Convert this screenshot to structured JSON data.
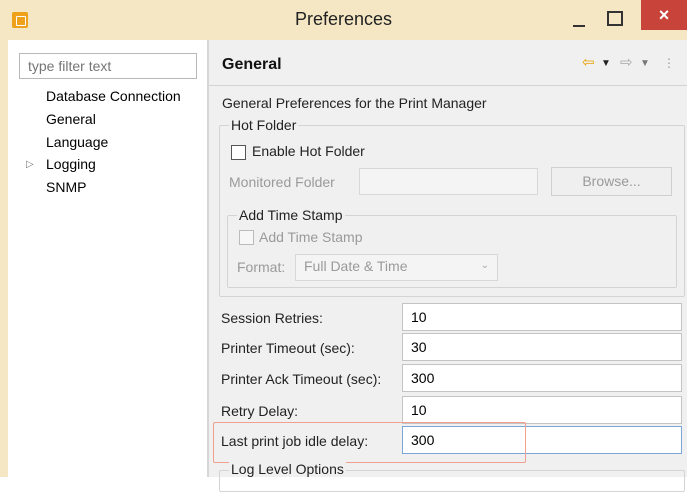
{
  "window": {
    "title": "Preferences",
    "close_glyph": "×"
  },
  "filter": {
    "placeholder": "type filter text"
  },
  "tree": {
    "items": [
      "Database Connection",
      "General",
      "Language",
      "Logging",
      "SNMP"
    ],
    "expander_glyph": "▷"
  },
  "page": {
    "title": "General",
    "description": "General Preferences for the Print Manager",
    "nav": {
      "back_glyph": "⇦",
      "forward_glyph": "⇨",
      "dropdown_glyph": "▼",
      "menu_glyph": "⋮"
    }
  },
  "hot_folder": {
    "group_title": "Hot Folder",
    "enable_label": "Enable Hot Folder",
    "monitored_label": "Monitored Folder",
    "monitored_value": "",
    "browse_label": "Browse...",
    "timestamp_group_title": "Add Time Stamp",
    "timestamp_label": "Add Time Stamp",
    "format_label": "Format:",
    "format_value": "Full Date & Time"
  },
  "fields": [
    {
      "label": "Session Retries:",
      "value": "10"
    },
    {
      "label": "Printer Timeout (sec):",
      "value": "30"
    },
    {
      "label": "Printer Ack Timeout (sec):",
      "value": "300"
    },
    {
      "label": "Retry Delay:",
      "value": "10"
    },
    {
      "label": "Last print job idle delay:",
      "value": "300"
    }
  ],
  "log_level": {
    "group_title": "Log Level Options"
  },
  "colors": {
    "accent": "#f0a08e",
    "selection": "#f5e7c4"
  }
}
